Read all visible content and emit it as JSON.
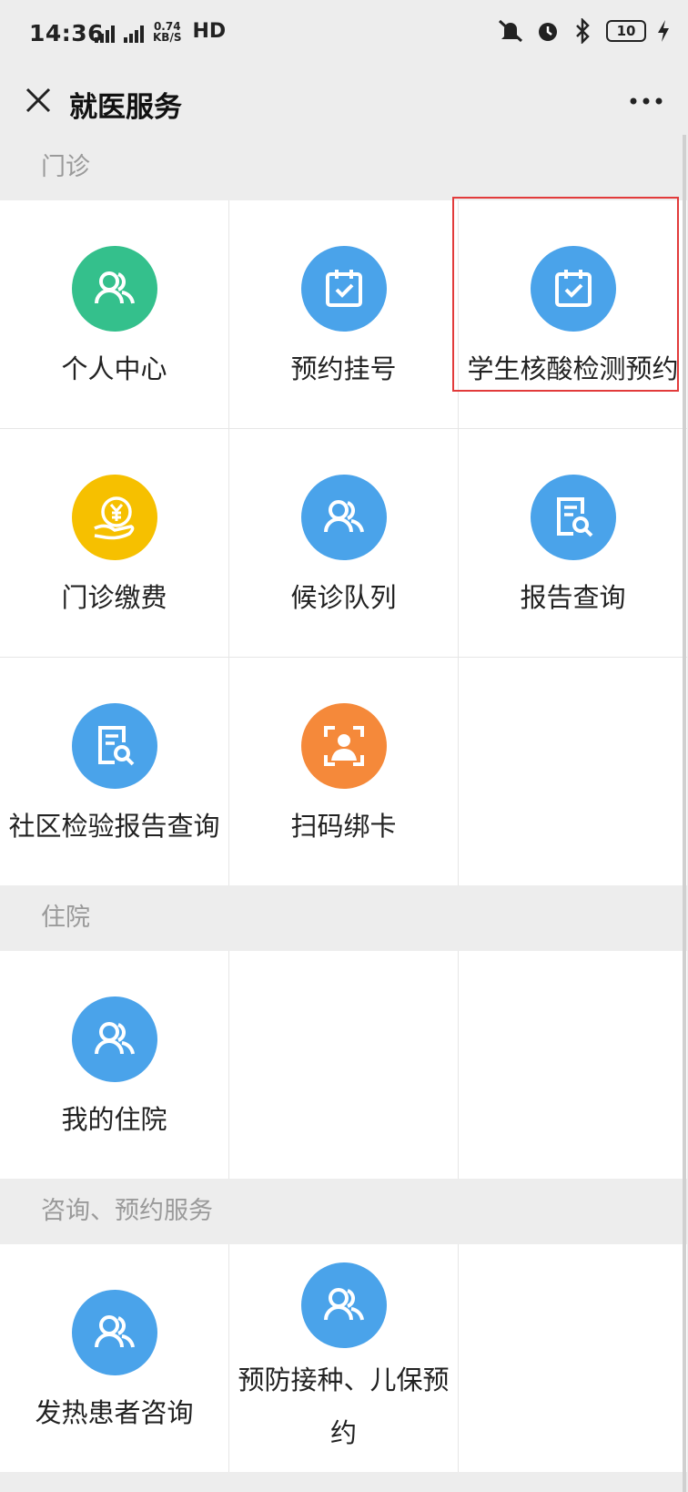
{
  "status_bar": {
    "time": "14:36",
    "network_label": "4G",
    "speed_value": "0.74",
    "speed_unit": "KB/S",
    "hd_label": "HD",
    "battery": "10"
  },
  "nav": {
    "title": "就医服务"
  },
  "sections": [
    {
      "title": "门诊",
      "items": [
        {
          "label": "个人中心",
          "icon": "users-icon",
          "color": "#34c08c"
        },
        {
          "label": "预约挂号",
          "icon": "calendar-check-icon",
          "color": "#4aa3ea"
        },
        {
          "label": "学生核酸检测预约",
          "icon": "calendar-check-icon",
          "color": "#4aa3ea"
        },
        {
          "label": "门诊缴费",
          "icon": "yuan-payment-icon",
          "color": "#f6c000"
        },
        {
          "label": "候诊队列",
          "icon": "users-icon",
          "color": "#4aa3ea"
        },
        {
          "label": "报告查询",
          "icon": "report-search-icon",
          "color": "#4aa3ea"
        },
        {
          "label": "社区检验报告查询",
          "icon": "report-search-icon",
          "color": "#4aa3ea"
        },
        {
          "label": "扫码绑卡",
          "icon": "face-scan-icon",
          "color": "#f5893a"
        }
      ]
    },
    {
      "title": "住院",
      "items": [
        {
          "label": "我的住院",
          "icon": "users-icon",
          "color": "#4aa3ea"
        }
      ]
    },
    {
      "title": "咨询、预约服务",
      "items": [
        {
          "label": "发热患者咨询",
          "icon": "users-icon",
          "color": "#4aa3ea"
        },
        {
          "label": "预防接种、儿保预约",
          "icon": "users-icon",
          "color": "#4aa3ea"
        }
      ]
    }
  ]
}
